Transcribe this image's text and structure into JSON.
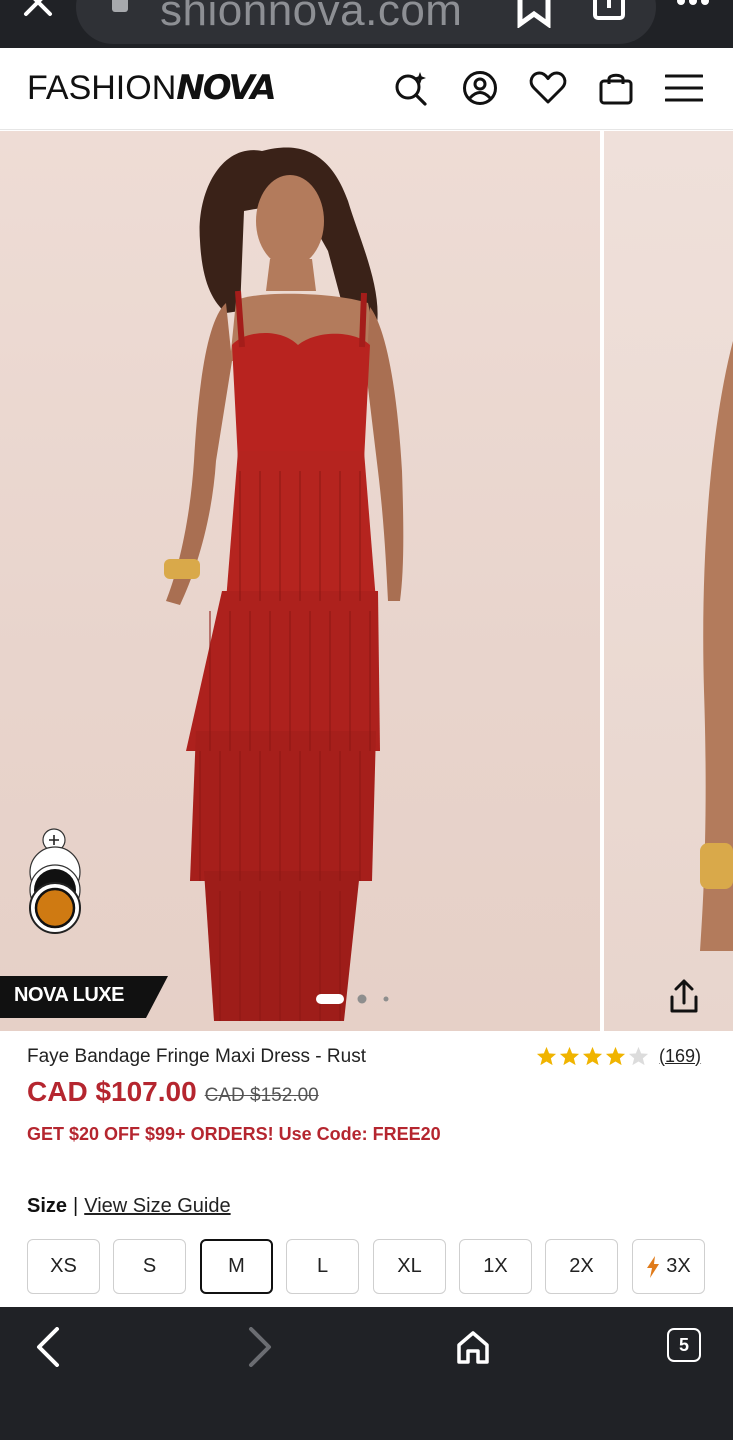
{
  "browser": {
    "url_text": "shionnova.com",
    "tabs_count": "5"
  },
  "header": {
    "logo_light": "FASHION",
    "logo_bold": "NOVA",
    "icons": [
      "ai-search-icon",
      "account-icon",
      "wishlist-heart-icon",
      "shopping-bag-icon",
      "hamburger-menu-icon"
    ]
  },
  "gallery": {
    "badge": "NOVA LUXE",
    "swatch_add": "+",
    "swatches": [
      "black",
      "rust"
    ],
    "active_slide": 1,
    "slide_count": 3
  },
  "product": {
    "title": "Faye Bandage Fringe Maxi Dress - Rust",
    "rating": 4,
    "rating_max": 5,
    "reviews": "(169)",
    "price": "CAD $107.00",
    "compare_price": "CAD $152.00",
    "promo": "GET $20 OFF $99+ ORDERS! Use Code: FREE20"
  },
  "size": {
    "label": "Size",
    "separator": "|",
    "guide_link": "View Size Guide",
    "options": [
      "XS",
      "S",
      "M",
      "L",
      "XL",
      "1X",
      "2X",
      "3X"
    ],
    "selected": "M",
    "low_stock": "3X"
  },
  "colors": {
    "accent": "#b5262f",
    "star": "#f0b400",
    "bar": "#202226",
    "dress": "#b8231f"
  }
}
